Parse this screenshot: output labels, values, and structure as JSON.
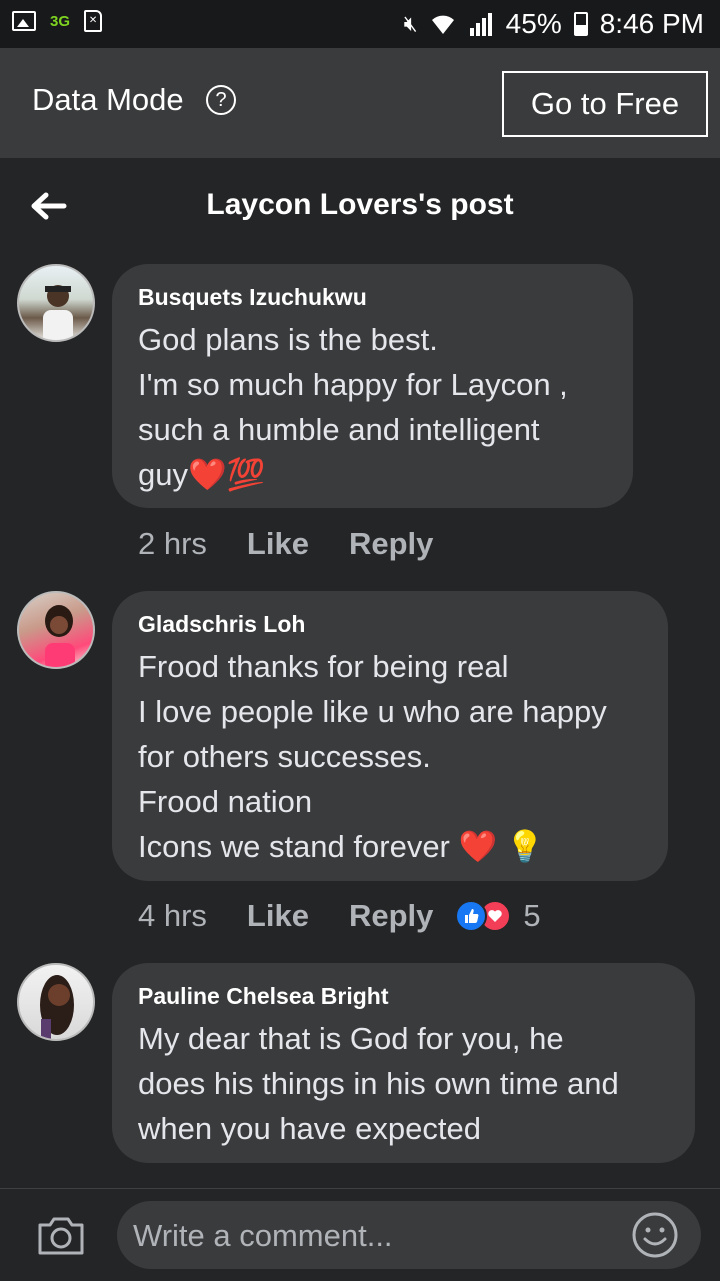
{
  "status_bar": {
    "network": "3G",
    "battery": "45%",
    "time": "8:46 PM"
  },
  "data_mode": {
    "label": "Data Mode",
    "help": "?",
    "cta": "Go to Free"
  },
  "header": {
    "title": "Laycon Lovers's post"
  },
  "comments": [
    {
      "author": "Busquets Izuchukwu",
      "lines": [
        "God plans is the best.",
        "I'm so much happy for Laycon ,",
        "such a humble and intelligent",
        "guy❤️💯"
      ],
      "time": "2 hrs",
      "like": "Like",
      "reply": "Reply"
    },
    {
      "author": "Gladschris Loh",
      "lines": [
        "Frood thanks for being real",
        "I love people like u who are happy",
        "for others successes.",
        "Frood nation",
        "Icons we stand forever ❤️ 💡"
      ],
      "time": "4 hrs",
      "like": "Like",
      "reply": "Reply",
      "reaction_count": "5"
    },
    {
      "author": "Pauline Chelsea Bright",
      "lines": [
        "My dear that is God for you, he",
        "does his things in his own time and",
        "when you have expected"
      ]
    }
  ],
  "composer": {
    "placeholder": "Write a comment..."
  },
  "colors": {
    "background": "#242526",
    "bubble": "#3a3b3c",
    "like_blue": "#1877f2",
    "love_red": "#f33e58"
  }
}
